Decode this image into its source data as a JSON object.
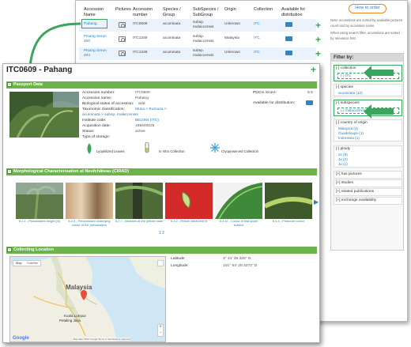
{
  "back": {
    "how_to_order": "How to order",
    "headers": {
      "accession_name": "Accession\nName",
      "pictures": "Pictures",
      "accession_number": "Accession\nnumber",
      "species_group": "Species /\nGroup",
      "subspecies": "SubSpecies /\nSubGroup",
      "origin": "Origin",
      "collection": "Collection",
      "available": "Available for\ndistribution"
    },
    "rows": [
      {
        "name": "Pahang",
        "number": "ITC0609",
        "species": "acuminata",
        "subspecies": "subsp.\nmalaccensis",
        "origin": "Unknown",
        "collection": "ITC"
      },
      {
        "name": "Pisang Serun\n400",
        "number": "ITC1349",
        "species": "acuminata",
        "subspecies": "subsp.\nmalaccensis",
        "origin": "Malaysia",
        "collection": "ITC"
      },
      {
        "name": "Pisang Serun\n404",
        "number": "ITC1348",
        "species": "acuminata",
        "subspecies": "subsp.\nmalaccensis",
        "origin": "Unknown",
        "collection": "ITC"
      }
    ],
    "notes": [
      "Note: accessions are sorted by available pictures",
      "count and by accession name",
      "When using search filter, accessions are sorted",
      "by relevance first."
    ],
    "filter": {
      "title": "Filter by:",
      "groups": [
        {
          "head": "[-] collection",
          "items": [
            "(-) ITC"
          ]
        },
        {
          "head": "[-] species",
          "items": [
            "acuminata (12)"
          ]
        },
        {
          "head": "[-] subspecies",
          "items": [
            "(-) malaccensis"
          ]
        },
        {
          "head": "[-] country of origin",
          "items": [
            "Malaysia (4)",
            "Guadeloupe (1)",
            "Indonesia (1)"
          ]
        },
        {
          "head": "[-] ploidy",
          "items": [
            "2x (9)",
            "4x (2)",
            "3x (1)"
          ]
        },
        {
          "head": "[+] has pictures",
          "items": []
        },
        {
          "head": "[+] studies",
          "items": []
        },
        {
          "head": "[+] related publications",
          "items": []
        },
        {
          "head": "[+] exchange availability",
          "items": []
        }
      ]
    }
  },
  "front": {
    "title": "ITC0609 - Pahang",
    "passport_header": "Passport Data",
    "fields": [
      {
        "label": "Accession number:",
        "value": "ITC0609"
      },
      {
        "label": "Accession name:",
        "value": "Pahang"
      },
      {
        "label": "Biological status of accession:",
        "value": "wild"
      },
      {
        "label": "Taxonomic classification:",
        "value": "Musa > Eumusa >"
      },
      {
        "label": "",
        "value": "acuminata > subsp. malaccensis"
      },
      {
        "label": "Institute code:",
        "value": "BEL084 (ITC)"
      },
      {
        "label": "Acquisition date:",
        "value": "1984/05/25"
      },
      {
        "label": "Status:",
        "value": "active"
      },
      {
        "label": "Type of storage:",
        "value": ""
      }
    ],
    "pdc_label": "PDCm Score:",
    "pdc_value": "8.5",
    "available_label": "Available for distribution:",
    "storage": [
      "Lyophilized Leaves",
      "In Vitro Collection",
      "Cryopreserved Collection"
    ],
    "morph_header": "Morphological Characterisation at Neufchâteau (CIRAD)",
    "morph_captions": [
      "6.2.1 - Pseudostem height [m]",
      "6.2.5 - Predominant underlying colour of the pseudostem",
      "6.2.7 - Blotches at the petiole base",
      "6.3.2 - Petiole canal leaf III",
      "6.3.12 - Colour of leaf upper surface",
      "6.4.4 - Peduncle colour"
    ],
    "pager": "1 2",
    "collecting_header": "Collecting Location",
    "map_buttons": [
      "Map",
      "Satellite"
    ],
    "map_labels": {
      "country": "Malaysia",
      "city1": "Kuala Lumpur",
      "city2": "Petaling Jaya",
      "google": "Google",
      "footer": "Map data ©2017 Google  Terms of Use  Report a map error"
    },
    "latitude_label": "Latitude:",
    "latitude_value": "3° 31' 35.328\" N",
    "longitude_label": "Longitude:",
    "longitude_value": "101° 54' 20.3272\" E"
  },
  "colors": {
    "accent_green": "#6bb34a",
    "arrow_green": "#3aa55c",
    "link_blue": "#2a7fbf",
    "order_orange": "#e8891d"
  }
}
